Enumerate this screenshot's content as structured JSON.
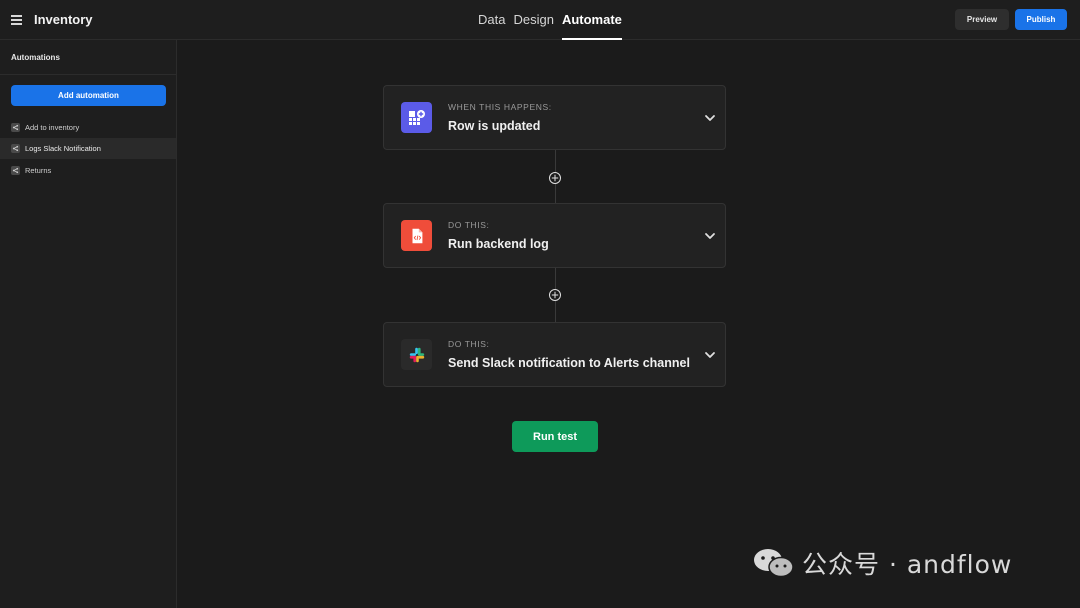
{
  "header": {
    "app_title": "Inventory",
    "tabs": [
      {
        "label": "Data",
        "active": false
      },
      {
        "label": "Design",
        "active": false
      },
      {
        "label": "Automate",
        "active": true
      }
    ],
    "preview_label": "Preview",
    "publish_label": "Publish"
  },
  "sidebar": {
    "title": "Automations",
    "add_label": "Add automation",
    "items": [
      {
        "label": "Add to inventory",
        "selected": false
      },
      {
        "label": "Logs Slack Notification",
        "selected": true
      },
      {
        "label": "Returns",
        "selected": false
      }
    ]
  },
  "flow": {
    "steps": [
      {
        "kicker": "WHEN THIS HAPPENS:",
        "title": "Row is updated",
        "icon": "table-row-icon",
        "color": "#5b5be8"
      },
      {
        "kicker": "DO THIS:",
        "title": "Run backend log",
        "icon": "code-file-icon",
        "color": "#ef4d3a"
      },
      {
        "kicker": "DO THIS:",
        "title": "Send Slack notification to Alerts channel",
        "icon": "slack-icon",
        "color": "#2a2a2a"
      }
    ],
    "run_test_label": "Run test"
  },
  "watermark": {
    "text": "公众号 · andflow"
  },
  "colors": {
    "accent": "#1a73e8",
    "run": "#0e9a5a",
    "background": "#1b1b1b"
  }
}
